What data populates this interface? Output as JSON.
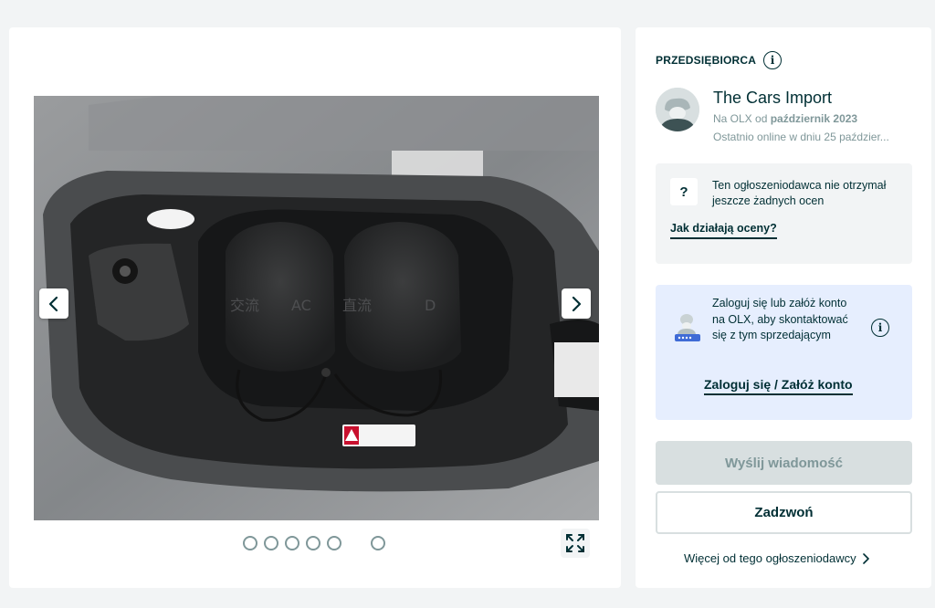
{
  "gallery": {
    "photo_alt": "Gniazdo ładowania AC/DC",
    "photo_labels": {
      "ac": "AC",
      "dc": "D",
      "ac_cn": "交流",
      "dc_cn": "直流"
    },
    "prev_icon": "chevron-left-icon",
    "next_icon": "chevron-right-icon",
    "expand_icon": "expand-icon",
    "dot_count": 6
  },
  "seller": {
    "type_label": "PRZEDSIĘBIORCA",
    "info_glyph": "i",
    "name": "The Cars Import",
    "since_prefix": "Na OLX od",
    "since_date": "październik 2023",
    "last_online": "Ostatnio online w dniu 25 paździer..."
  },
  "rating": {
    "icon_glyph": "?",
    "text": "Ten ogłoszeniodawca nie otrzymał jeszcze żadnych ocen",
    "link": "Jak działają oceny?"
  },
  "login": {
    "text": "Zaloguj się lub załóż konto na OLX, aby skontaktować się z tym sprzedającym",
    "info_glyph": "i",
    "link": "Zaloguj się / Załóż konto"
  },
  "actions": {
    "message_label": "Wyślij wiadomość",
    "call_label": "Zadzwoń",
    "more_label": "Więcej od tego ogłoszeniodawcy"
  },
  "colors": {
    "primary": "#002f34",
    "muted": "#7f9799",
    "disabled_bg": "#d8dfe0",
    "login_bg": "#e6eefe",
    "page_bg": "#f2f4f5"
  }
}
